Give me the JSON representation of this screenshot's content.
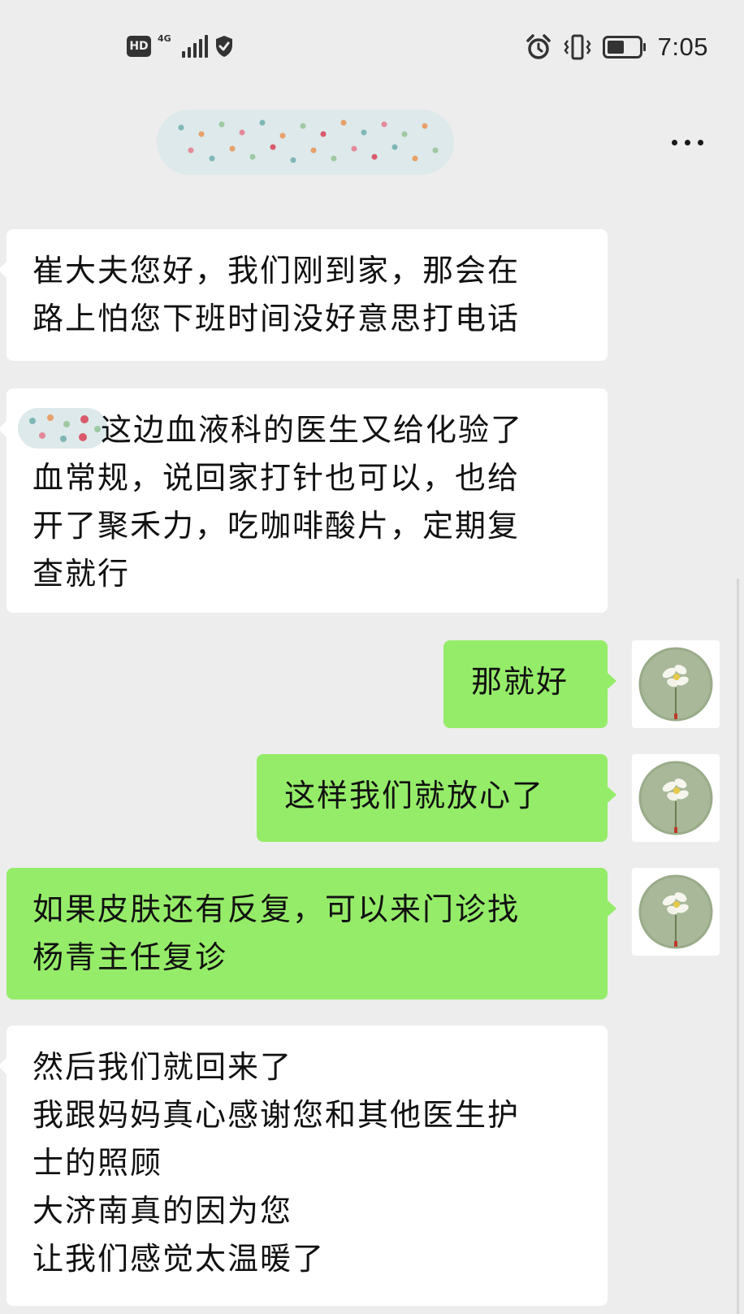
{
  "status_bar": {
    "hd_label": "HD",
    "network_label": "4G",
    "time": "7:05",
    "icons": [
      "hd-icon",
      "signal-4g-icon",
      "shield-check-icon",
      "alarm-icon",
      "vibrate-icon",
      "battery-icon"
    ]
  },
  "nav": {
    "chat_title_blurred": true,
    "more_icon": "more-dots-icon"
  },
  "messages": [
    {
      "direction": "in",
      "lines": [
        "崔大夫您好，我们刚到家，那会在",
        "路上怕您下班时间没好意思打电话"
      ]
    },
    {
      "direction": "in",
      "lines": [
        "这边血液科的医生又给化验了",
        "血常规，说回家打针也可以，也给",
        "开了聚禾力，吃咖啡酸片，定期复",
        "查就行"
      ]
    },
    {
      "direction": "out",
      "lines": [
        "那就好"
      ]
    },
    {
      "direction": "out",
      "lines": [
        "这样我们就放心了"
      ]
    },
    {
      "direction": "out",
      "lines": [
        "如果皮肤还有反复，可以来门诊找",
        "杨青主任复诊"
      ]
    },
    {
      "direction": "in",
      "lines": [
        "然后我们就回来了",
        "我跟妈妈真心感谢您和其他医生护",
        "士的照顾",
        "大济南真的因为您",
        "让我们感觉太温暖了"
      ]
    }
  ],
  "colors": {
    "background": "#ededed",
    "incoming_bubble": "#ffffff",
    "outgoing_bubble": "#95ec69",
    "text": "#111111"
  }
}
